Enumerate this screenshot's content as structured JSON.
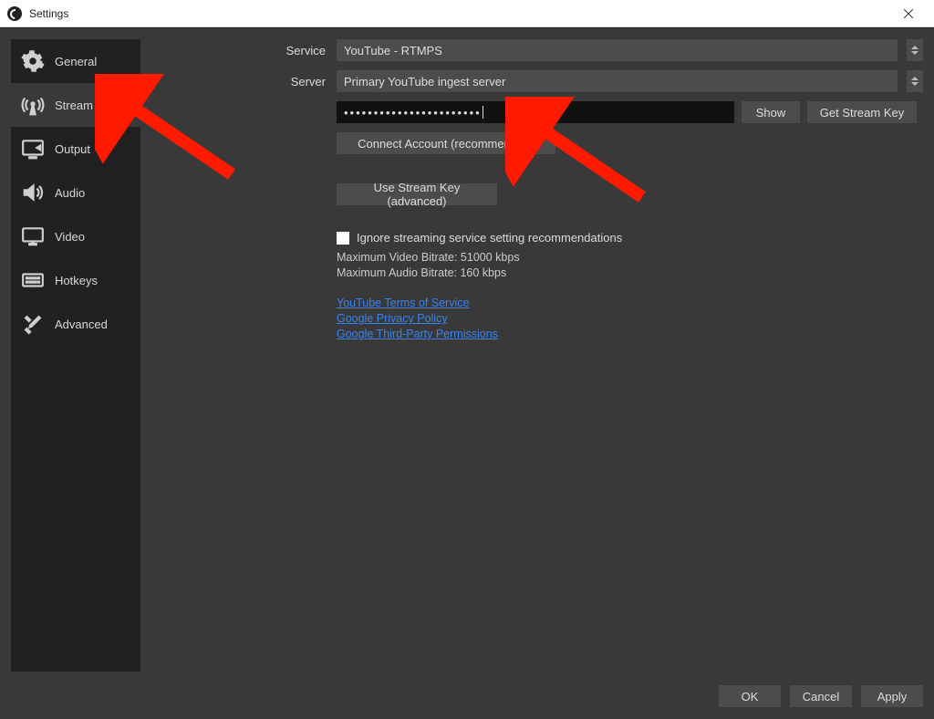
{
  "window": {
    "title": "Settings"
  },
  "sidebar": {
    "items": [
      {
        "label": "General"
      },
      {
        "label": "Stream"
      },
      {
        "label": "Output"
      },
      {
        "label": "Audio"
      },
      {
        "label": "Video"
      },
      {
        "label": "Hotkeys"
      },
      {
        "label": "Advanced"
      }
    ]
  },
  "form": {
    "service_label": "Service",
    "service_value": "YouTube - RTMPS",
    "server_label": "Server",
    "server_value": "Primary YouTube ingest server",
    "stream_key_mask": "•••••••••••••••••••••••",
    "show_label": "Show",
    "get_key_label": "Get Stream Key",
    "connect_label": "Connect Account (recommended)",
    "use_key_label": "Use Stream Key (advanced)"
  },
  "advice": {
    "ignore_label": "Ignore streaming service setting recommendations",
    "max_video": "Maximum Video Bitrate: 51000 kbps",
    "max_audio": "Maximum Audio Bitrate: 160 kbps"
  },
  "links": {
    "tos": "YouTube Terms of Service",
    "privacy": "Google Privacy Policy",
    "thirdparty": "Google Third-Party Permissions"
  },
  "footer": {
    "ok": "OK",
    "cancel": "Cancel",
    "apply": "Apply"
  }
}
